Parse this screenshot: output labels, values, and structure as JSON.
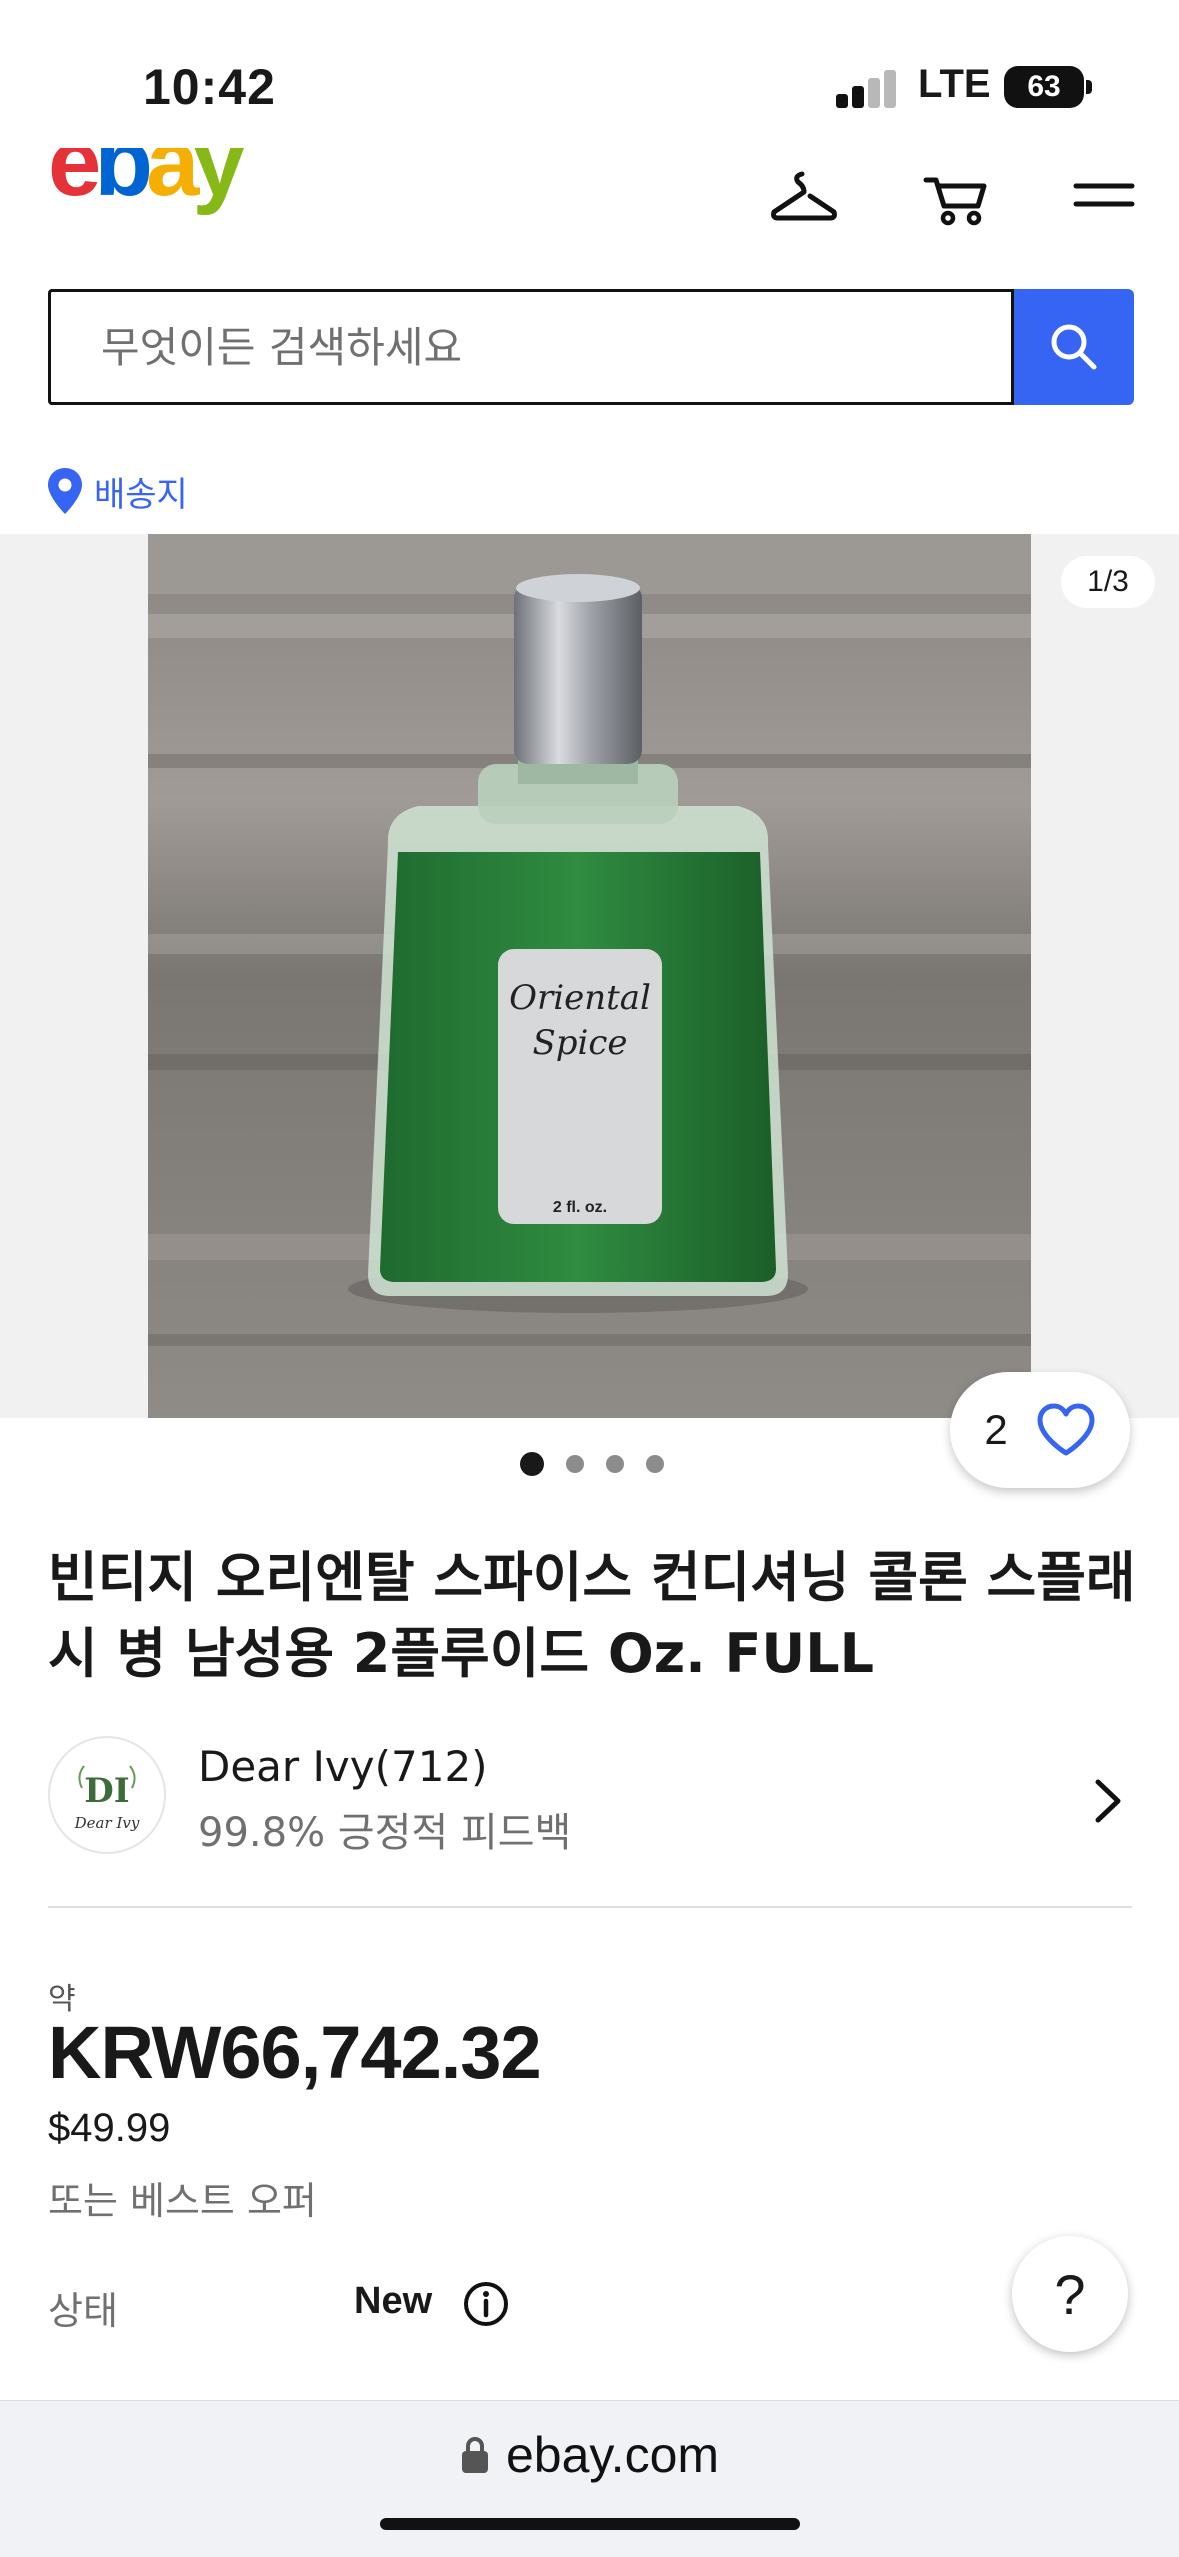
{
  "status_bar": {
    "time": "10:42",
    "network": "LTE",
    "battery": "63"
  },
  "header": {
    "logo": "ebay",
    "logo_colors": [
      "#e53238",
      "#0064d2",
      "#f5af02",
      "#86b817"
    ],
    "icons": [
      "hanger-icon",
      "cart-icon",
      "menu-icon"
    ]
  },
  "search": {
    "placeholder": "무엇이든 검색하세요"
  },
  "shipping": {
    "label": "배송지"
  },
  "gallery": {
    "counter": "1/3",
    "watch_count": "2",
    "label_line1": "Oriental",
    "label_line2": "Spice",
    "label_size": "2 fl. oz.",
    "dots": 4,
    "active_dot": 0
  },
  "item": {
    "title": "빈티지 오리엔탈 스파이스 컨디셔닝 콜론 스플래시 병 남성용 2플루이드 Oz. FULL"
  },
  "seller": {
    "avatar_initials": "DI",
    "avatar_caption": "Dear Ivy",
    "name": "Dear Ivy(712)",
    "feedback": "99.8% 긍정적 피드백"
  },
  "price": {
    "approx_label": "약",
    "krw": "KRW66,742.32",
    "usd": "$49.99",
    "best_offer": "또는 베스트 오퍼"
  },
  "condition": {
    "label": "상태",
    "value": "New"
  },
  "help": {
    "label": "?"
  },
  "browser": {
    "url": "ebay.com"
  },
  "colors": {
    "accent": "#3665f3",
    "text": "#191919",
    "muted": "#707070"
  }
}
